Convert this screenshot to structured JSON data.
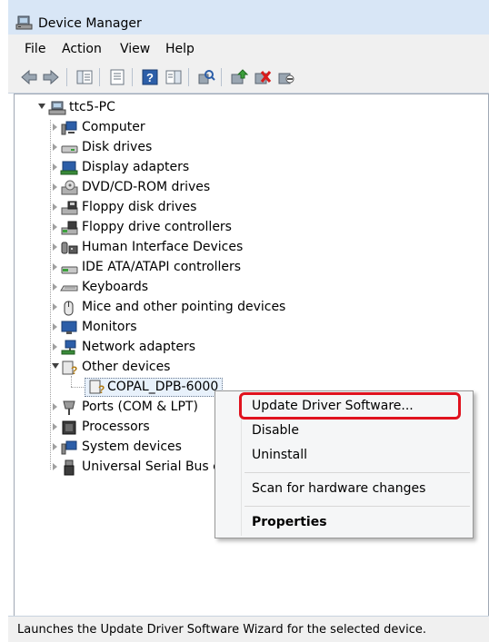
{
  "window": {
    "title": "Device Manager"
  },
  "menu": [
    "File",
    "Action",
    "View",
    "Help"
  ],
  "toolbar": {
    "buttons": [
      "back-icon",
      "forward-icon",
      "show-hide-tree-icon",
      "properties-icon",
      "help-icon",
      "action-pane-icon",
      "scan-hardware-icon",
      "update-driver-icon",
      "uninstall-icon",
      "disable-icon"
    ]
  },
  "tree": {
    "root": "ttc5-PC",
    "categories": [
      "Computer",
      "Disk drives",
      "Display adapters",
      "DVD/CD-ROM drives",
      "Floppy disk drives",
      "Floppy drive controllers",
      "Human Interface Devices",
      "IDE ATA/ATAPI controllers",
      "Keyboards",
      "Mice and other pointing devices",
      "Monitors",
      "Network adapters",
      "Other devices",
      "Ports (COM & LPT)",
      "Processors",
      "System devices",
      "Universal Serial Bus c"
    ],
    "other_devices_child": "COPAL_DPB-6000"
  },
  "context_menu": {
    "update": "Update Driver Software...",
    "disable": "Disable",
    "uninstall": "Uninstall",
    "scan": "Scan for hardware changes",
    "properties": "Properties"
  },
  "status": "Launches the Update Driver Software Wizard for the selected device.",
  "colors": {
    "highlight": "#e0121e",
    "titlebar": "#d8e6f6"
  }
}
